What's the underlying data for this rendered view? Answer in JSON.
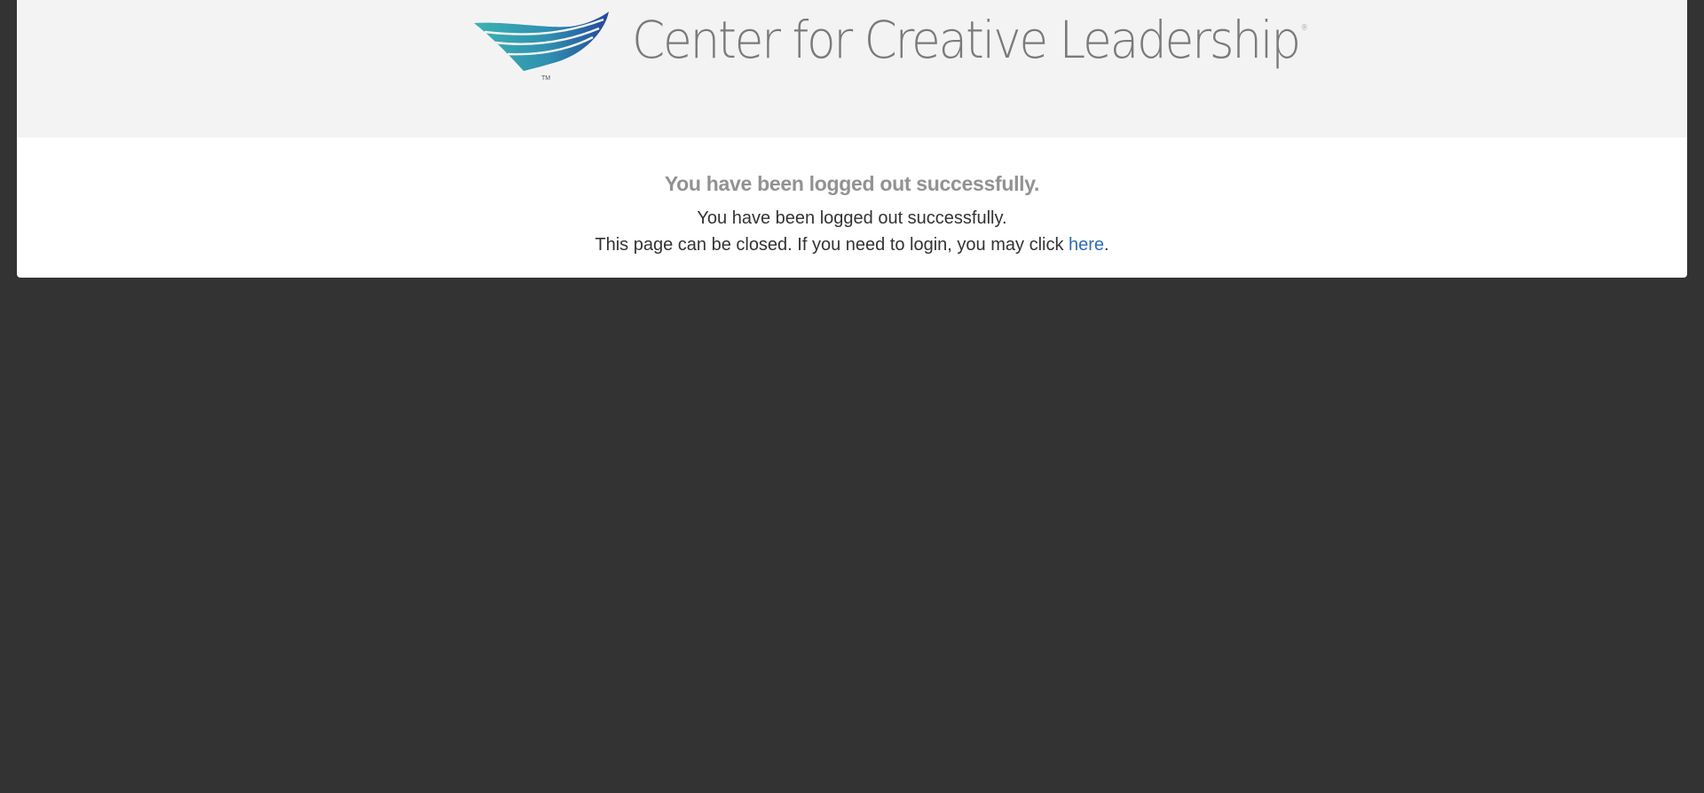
{
  "header": {
    "logo": {
      "wordmark": "Center for Creative Leadership",
      "registered_mark": "®",
      "trademark": "TM",
      "colors": {
        "teal": "#3bb3b3",
        "blue": "#24499a",
        "text": "#7a7a7a"
      }
    },
    "background": "#f3f3f3"
  },
  "main": {
    "heading": "You have been logged out successfully.",
    "message_line1": "You have been logged out successfully.",
    "message_line2_prefix": "This page can be closed. If you need to login, you may click ",
    "login_link_label": "here",
    "message_line2_suffix": "."
  },
  "colors": {
    "page_background": "#333333",
    "card_background": "#ffffff",
    "link": "#2f6cb3",
    "heading": "#929292"
  }
}
